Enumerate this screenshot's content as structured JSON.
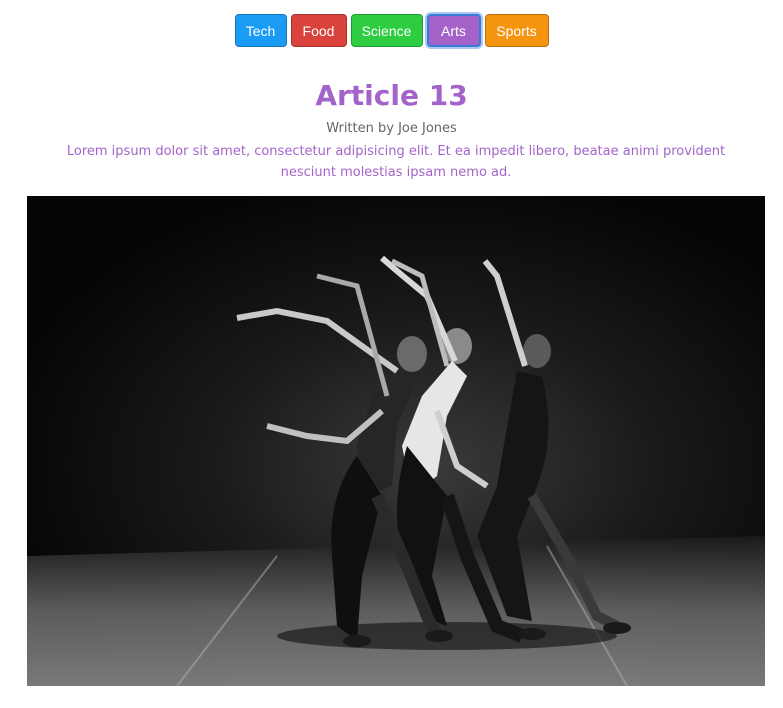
{
  "nav": {
    "buttons": [
      {
        "label": "Tech",
        "color": "#1a9cf5",
        "active": false
      },
      {
        "label": "Food",
        "color": "#d9433b",
        "active": false
      },
      {
        "label": "Science",
        "color": "#2ecc40",
        "active": false
      },
      {
        "label": "Arts",
        "color": "#a463c9",
        "active": true
      },
      {
        "label": "Sports",
        "color": "#f5950f",
        "active": false
      }
    ]
  },
  "article": {
    "title": "Article 13",
    "byline": "Written by Joe Jones",
    "body": "Lorem ipsum dolor sit amet, consectetur adipisicing elit. Et ea impedit libero, beatae animi provident nesciunt molestias ipsam nemo ad.",
    "accent_color": "#a463c9",
    "image": {
      "icon": "dancers-photo",
      "tone": "black-and-white"
    }
  }
}
